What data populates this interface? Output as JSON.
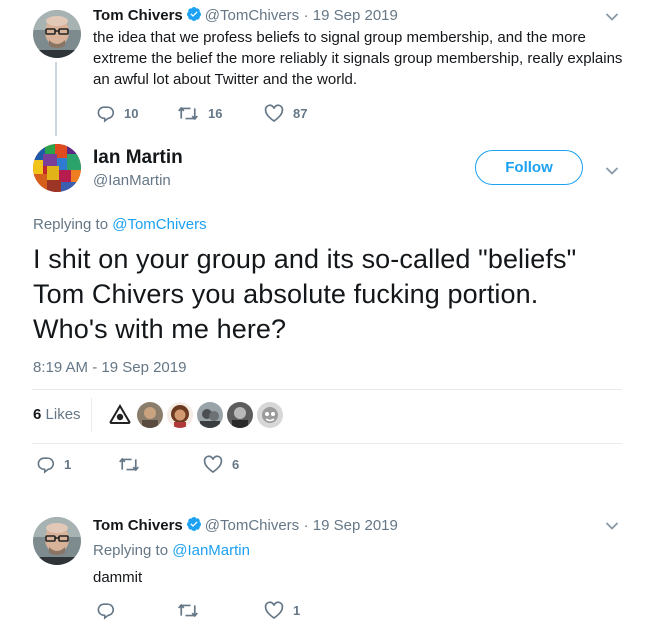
{
  "parent_tweet": {
    "name": "Tom Chivers",
    "handle": "@TomChivers",
    "date": "· 19 Sep 2019",
    "text": "the idea that we profess beliefs to signal group membership, and the more extreme the belief the more reliably it signals group membership, really explains an awful lot about Twitter and the world.",
    "replies": "10",
    "retweets": "16",
    "likes": "87"
  },
  "main_tweet": {
    "name": "Ian Martin",
    "handle": "@IanMartin",
    "follow_label": "Follow",
    "replying_prefix": "Replying to",
    "replying_to": "@TomChivers",
    "text": "I shit on your group and its so-called \"beliefs\" Tom Chivers you absolute fucking portion. Who's with me here?",
    "timestamp": "8:19 AM - 19 Sep 2019",
    "likes_count": "6",
    "likes_label": "Likes",
    "replies": "1",
    "retweets": "",
    "likes": "6"
  },
  "reply_tweet": {
    "name": "Tom Chivers",
    "handle": "@TomChivers",
    "date": "· 19 Sep 2019",
    "replying_prefix": "Replying to",
    "replying_to": "@IanMartin",
    "text": "dammit",
    "replies": "",
    "retweets": "",
    "likes": "1"
  },
  "icons": {
    "verified": "verified-badge-icon",
    "reply": "reply-icon",
    "retweet": "retweet-icon",
    "like": "heart-icon",
    "menu": "chevron-down-icon"
  },
  "colors": {
    "accent": "#1da1f2",
    "secondary_text": "#657786",
    "primary_text": "#14171a",
    "divider": "#e6ecf0"
  }
}
